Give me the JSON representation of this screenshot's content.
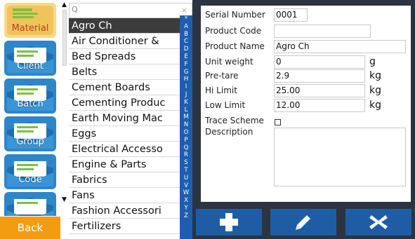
{
  "nav": {
    "items": [
      {
        "label": "Material",
        "active": true
      },
      {
        "label": "Client",
        "active": false
      },
      {
        "label": "Batch",
        "active": false
      },
      {
        "label": "Group",
        "active": false
      },
      {
        "label": "Code",
        "active": false
      },
      {
        "label": "",
        "active": false
      }
    ],
    "back_label": "Back"
  },
  "search": {
    "icon_glyph": "Q",
    "clear_glyph": "×"
  },
  "products": [
    "Agro Ch",
    "Air Conditioner &",
    "Bed Spreads",
    "Belts",
    "Cement Boards",
    "Cementing Produc",
    "Earth Moving Mac",
    "Eggs",
    "Electrical Accesso",
    "Engine & Parts",
    "Fabrics",
    "Fans",
    "Fashion Accessori",
    "Fertilizers"
  ],
  "selected_product_index": 0,
  "alphabet": [
    "*",
    "A",
    "B",
    "C",
    "D",
    "E",
    "F",
    "G",
    "H",
    "I",
    "J",
    "K",
    "L",
    "M",
    "N",
    "O",
    "P",
    "Q",
    "R",
    "S",
    "T",
    "U",
    "V",
    "W",
    "X",
    "Y",
    "Z"
  ],
  "form": {
    "serial_number": {
      "label": "Serial Number",
      "value": "0001"
    },
    "product_code": {
      "label": "Product Code",
      "value": ""
    },
    "product_name": {
      "label": "Product Name",
      "value": "Agro Ch"
    },
    "unit_weight": {
      "label": "Unit weight",
      "value": "0",
      "unit": "g"
    },
    "pre_tare": {
      "label": "Pre-tare",
      "value": "2.9",
      "unit": "kg"
    },
    "hi_limit": {
      "label": "Hi Limit",
      "value": "25.00",
      "unit": "kg"
    },
    "low_limit": {
      "label": "Low Limit",
      "value": "12.00",
      "unit": "kg"
    },
    "trace_scheme": {
      "label": "Trace Scheme",
      "checked": false
    },
    "description": {
      "label": "Description",
      "value": ""
    }
  },
  "colors": {
    "accent_blue": "#1e5da6",
    "back_orange": "#f39c12",
    "panel_dark": "#2b3440",
    "selected_row": "#3c3c3c"
  }
}
